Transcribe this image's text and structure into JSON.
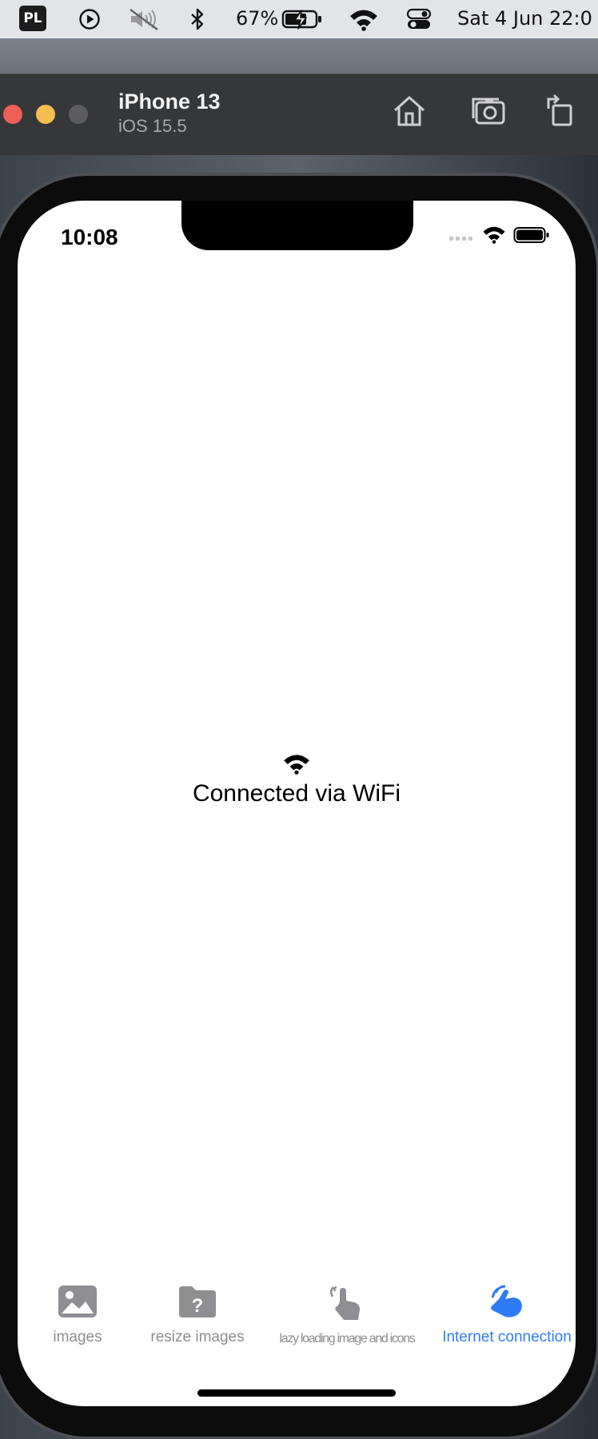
{
  "menubar": {
    "app_badge": "PL",
    "battery_percent": "67%",
    "datetime": "Sat 4 Jun  22:0",
    "icons": [
      "play-circle-icon",
      "mute-icon",
      "bluetooth-icon",
      "battery-charging-icon",
      "wifi-icon",
      "control-center-icon"
    ]
  },
  "simulator": {
    "device_name": "iPhone 13",
    "os_version": "iOS 15.5",
    "toolbar_icons": [
      "home-icon",
      "screenshot-icon",
      "rotate-icon"
    ],
    "traffic_colors": [
      "#ee5f57",
      "#f4be4f",
      "#5d5d60"
    ]
  },
  "phone": {
    "time": "10:08",
    "status_icons": [
      "signal-icon",
      "wifi-icon",
      "battery-icon"
    ],
    "content": {
      "icon": "wifi-icon",
      "message": "Connected via WiFi"
    },
    "tabs": [
      {
        "label": "images",
        "icon": "image-icon",
        "active": false
      },
      {
        "label": "resize images",
        "icon": "folder-question-icon",
        "active": false
      },
      {
        "label": "lazy loading image and icons",
        "icon": "hand-pointer-icon",
        "active": false
      },
      {
        "label": "Internet connection",
        "icon": "hand-tap-icon",
        "active": true
      }
    ],
    "colors": {
      "active": "#2f7bf5",
      "inactive": "#8e8e93"
    }
  }
}
